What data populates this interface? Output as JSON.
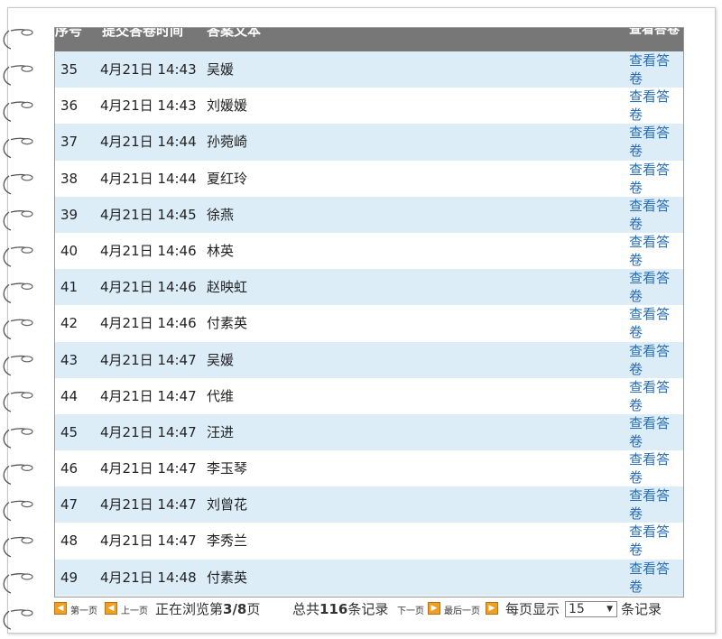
{
  "table": {
    "headers": {
      "index": "序号",
      "time": "提交答卷时间",
      "text": "答案文本",
      "view": "查看答卷"
    },
    "rows": [
      {
        "index": "35",
        "time": "4月21日 14:43",
        "name": "吴媛",
        "view": "查看答卷"
      },
      {
        "index": "36",
        "time": "4月21日 14:43",
        "name": "刘媛媛",
        "view": "查看答卷"
      },
      {
        "index": "37",
        "time": "4月21日 14:44",
        "name": "孙菀崎",
        "view": "查看答卷"
      },
      {
        "index": "38",
        "time": "4月21日 14:44",
        "name": "夏红玲",
        "view": "查看答卷"
      },
      {
        "index": "39",
        "time": "4月21日 14:45",
        "name": "徐燕",
        "view": "查看答卷"
      },
      {
        "index": "40",
        "time": "4月21日 14:46",
        "name": "林英",
        "view": "查看答卷"
      },
      {
        "index": "41",
        "time": "4月21日 14:46",
        "name": "赵映虹",
        "view": "查看答卷"
      },
      {
        "index": "42",
        "time": "4月21日 14:46",
        "name": "付素英",
        "view": "查看答卷"
      },
      {
        "index": "43",
        "time": "4月21日 14:47",
        "name": "吴媛",
        "view": "查看答卷"
      },
      {
        "index": "44",
        "time": "4月21日 14:47",
        "name": "代维",
        "view": "查看答卷"
      },
      {
        "index": "45",
        "time": "4月21日 14:47",
        "name": "汪进",
        "view": "查看答卷"
      },
      {
        "index": "46",
        "time": "4月21日 14:47",
        "name": "李玉琴",
        "view": "查看答卷"
      },
      {
        "index": "47",
        "time": "4月21日 14:47",
        "name": "刘曾花",
        "view": "查看答卷"
      },
      {
        "index": "48",
        "time": "4月21日 14:47",
        "name": "李秀兰",
        "view": "查看答卷"
      },
      {
        "index": "49",
        "time": "4月21日 14:48",
        "name": "付素英",
        "view": "查看答卷"
      }
    ]
  },
  "pager": {
    "first": "第一页",
    "prev": "上一页",
    "browsing_prefix": "正在浏览第",
    "browsing_page": "3/8",
    "browsing_suffix": "页",
    "total_prefix": "总共",
    "total_count": "116",
    "total_suffix": "条记录",
    "next": "下一页",
    "last": "最后一页",
    "per_page_label": "每页显示",
    "per_page_value": "15",
    "per_page_suffix": "条记录"
  },
  "icons": {
    "pager_button": "pager-arrow-icon",
    "spiral": "spiral-ring-icon"
  },
  "colors": {
    "header_bg": "#777777",
    "row_alt": "#dcedf8",
    "link": "#2a6db5",
    "pager_btn": "#f0a020"
  }
}
